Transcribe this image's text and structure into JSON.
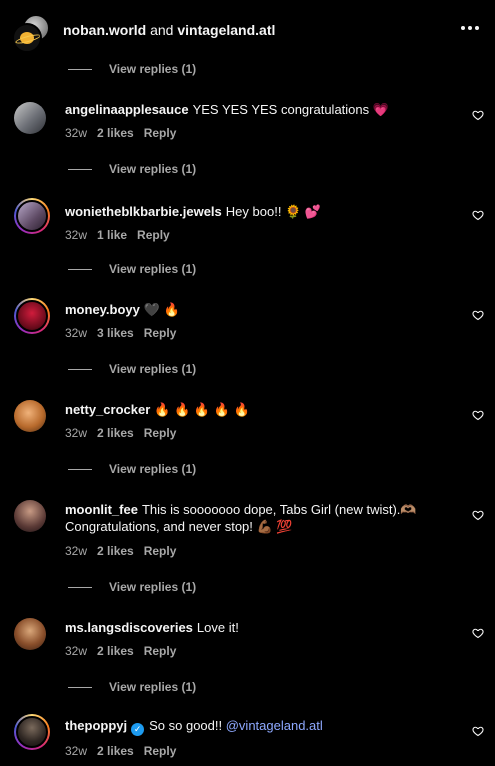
{
  "header": {
    "user1": "noban.world",
    "connector": "and",
    "user2": "vintageland.atl"
  },
  "view_replies_label": "View replies (1)",
  "comments": [
    {
      "username": "angelinaapplesauce",
      "text": "YES YES YES congratulations 💗",
      "time": "32w",
      "likes": "2 likes",
      "reply": "Reply"
    },
    {
      "username": "wonietheblkbarbie.jewels",
      "text": "Hey boo!! 🌻 💕",
      "time": "32w",
      "likes": "1 like",
      "reply": "Reply"
    },
    {
      "username": "money.boyy",
      "text": "🖤 🔥",
      "time": "32w",
      "likes": "3 likes",
      "reply": "Reply"
    },
    {
      "username": "netty_crocker",
      "text": "🔥 🔥 🔥 🔥 🔥",
      "time": "32w",
      "likes": "2 likes",
      "reply": "Reply"
    },
    {
      "username": "moonlit_fee",
      "text": "This is sooooooo dope, Tabs Girl (new twist).🫶🏽 Congratulations, and never stop! 💪🏾 💯",
      "time": "32w",
      "likes": "2 likes",
      "reply": "Reply"
    },
    {
      "username": "ms.langsdiscoveries",
      "text": "Love it!",
      "time": "32w",
      "likes": "2 likes",
      "reply": "Reply"
    },
    {
      "username": "thepoppyj",
      "text": "So so good!!",
      "mention": "@vintageland.atl",
      "time": "32w",
      "likes": "2 likes",
      "reply": "Reply"
    }
  ],
  "colors": {
    "background": "#000000",
    "secondary_text": "#a8a8a8",
    "mention": "#8ea9ff",
    "verified": "#1d9bf0"
  }
}
